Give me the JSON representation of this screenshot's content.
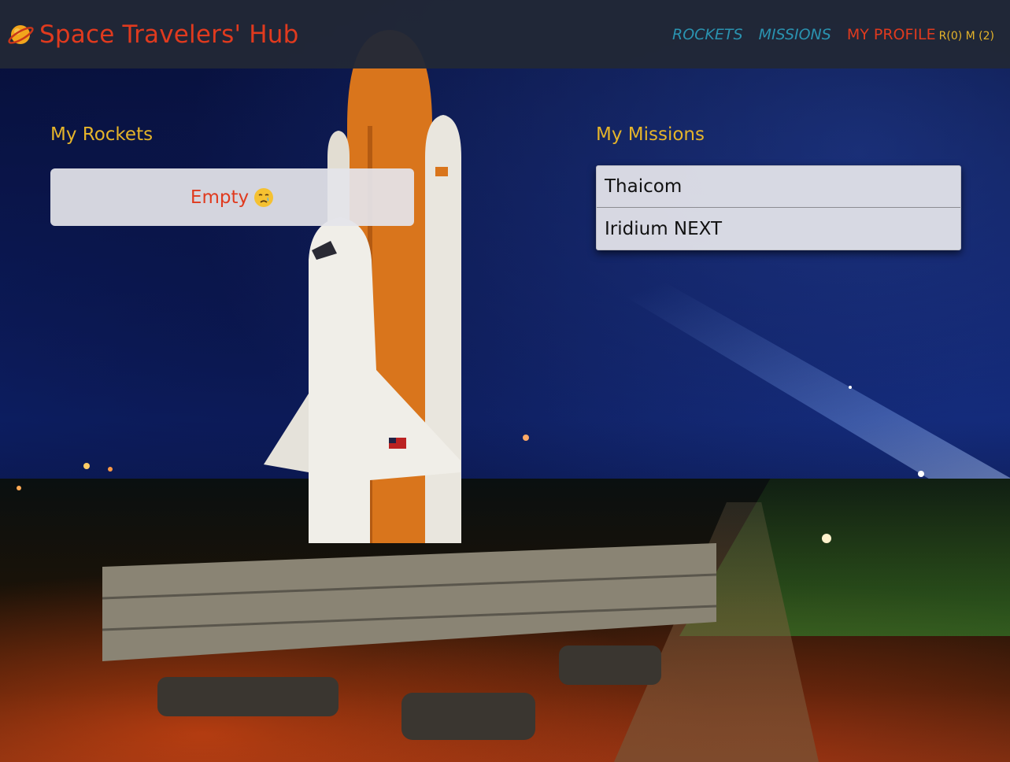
{
  "header": {
    "brand_icon": "ringed-planet-icon",
    "title": "Space Travelers' Hub",
    "nav": [
      {
        "label": "ROCKETS"
      },
      {
        "label": "MISSIONS"
      }
    ],
    "profile_label": "MY PROFILE",
    "counts": "R(0) M (2)"
  },
  "rockets": {
    "title": "My Rockets",
    "empty_text": "Empty",
    "empty_icon": "crying-face-icon"
  },
  "missions": {
    "title": "My Missions",
    "items": [
      {
        "name": "Thaicom"
      },
      {
        "name": "Iridium NEXT"
      }
    ]
  },
  "colors": {
    "brand": "#e03a1e",
    "accent": "#e5b42a",
    "nav_link": "#2a93b0",
    "navbar_bg": "#212836"
  }
}
